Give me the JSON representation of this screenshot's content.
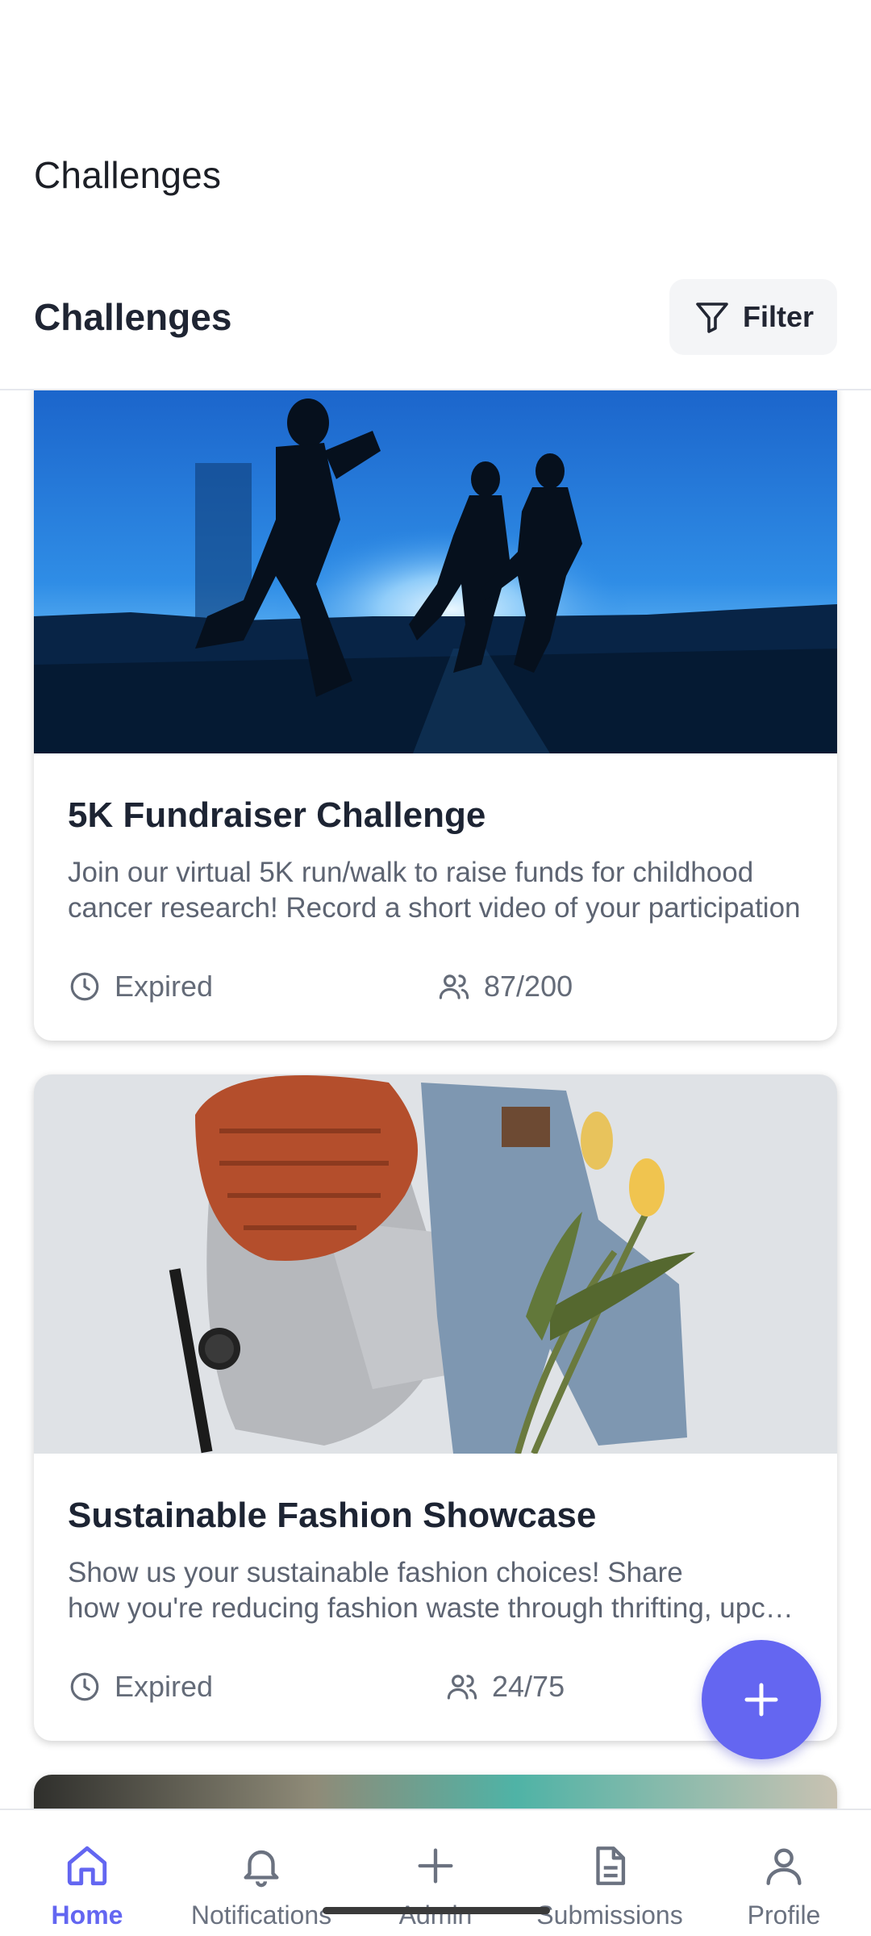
{
  "app": {
    "title": "Challenges"
  },
  "header": {
    "title": "Challenges",
    "filter_label": "Filter"
  },
  "challenges": [
    {
      "title": "5K Fundraiser Challenge",
      "description_line1": "Join our virtual 5K run/walk to raise funds for childhood",
      "description_line2": "cancer research! Record a short video of your participation",
      "status": "Expired",
      "participants": "87/200",
      "image_icon": "runners-silhouette-photo"
    },
    {
      "title": "Sustainable Fashion Showcase",
      "description_line1": "Show us your sustainable fashion choices! Share",
      "description_line2": "how you're reducing fashion waste through thrifting, upcycling",
      "status": "Expired",
      "participants": "24/75",
      "image_icon": "clothing-flatlay-photo"
    }
  ],
  "nav": {
    "items": [
      {
        "label": "Home",
        "icon": "home-icon",
        "active": true
      },
      {
        "label": "Notifications",
        "icon": "bell-icon"
      },
      {
        "label": "Admin",
        "icon": "plus-icon"
      },
      {
        "label": "Submissions",
        "icon": "document-icon"
      },
      {
        "label": "Profile",
        "icon": "person-icon"
      }
    ]
  },
  "colors": {
    "accent": "#6366f1",
    "text": "#1f2533",
    "muted": "#646b78"
  }
}
